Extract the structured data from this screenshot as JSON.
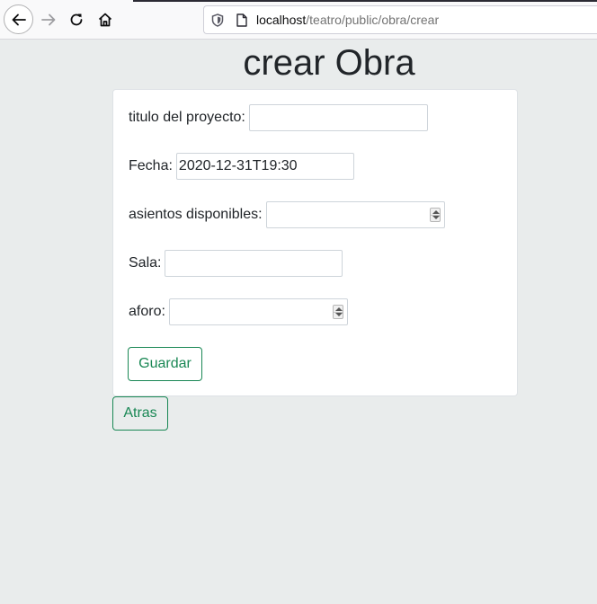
{
  "browser": {
    "url_host": "localhost",
    "url_path": "/teatro/public/obra/crear"
  },
  "page": {
    "title": "crear Obra"
  },
  "form": {
    "titulo_label": "titulo del proyecto:",
    "titulo_value": "",
    "fecha_label": "Fecha:",
    "fecha_value": "2020-12-31T19:30",
    "asientos_label": "asientos disponibles:",
    "asientos_value": "",
    "sala_label": "Sala:",
    "sala_value": "",
    "aforo_label": "aforo:",
    "aforo_value": "",
    "guardar_label": "Guardar"
  },
  "atras_label": "Atras",
  "colors": {
    "accent": "#198754",
    "background": "#e9ecec"
  }
}
